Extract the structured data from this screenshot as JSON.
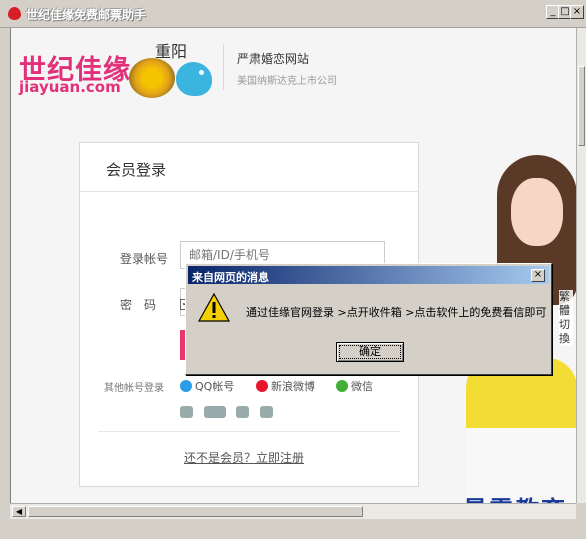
{
  "window": {
    "title": "世纪佳缘免费邮票助手",
    "min_label": "_",
    "max_label": "□",
    "close_label": "×"
  },
  "header": {
    "logo_cn": "世纪佳缘",
    "logo_en": "jiayuan.com",
    "calligraphy": "重阳",
    "tagline": "严肃婚恋网站",
    "subtagline": "美国纳斯达克上市公司"
  },
  "login": {
    "title": "会员登录",
    "account_label": "登录帐号",
    "account_placeholder": "邮箱/ID/手机号",
    "password_label": "密　码",
    "other_accounts_label": "其他帐号登录",
    "sso": [
      {
        "label": "QQ帐号",
        "color": "#2b9de8"
      },
      {
        "label": "新浪微博",
        "color": "#e6162d"
      },
      {
        "label": "微信",
        "color": "#41b035"
      }
    ],
    "register_link": "还不是会员？立即注册",
    "button_color": "#e8386a"
  },
  "side": {
    "switch_label": "繁\n體\n切\n換"
  },
  "dialog": {
    "title": "来自网页的消息",
    "message": "通过佳缘官网登录 >点开收件箱 >点击软件上的免费看信即可",
    "ok_label": "确定",
    "close_label": "×"
  },
  "watermark": "最需教育"
}
